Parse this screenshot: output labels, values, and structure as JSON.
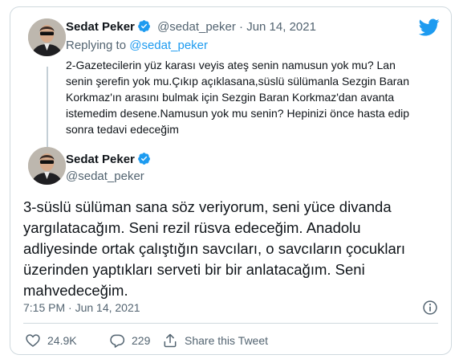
{
  "colors": {
    "accent": "#1d9bf0",
    "secondary_text": "#536471",
    "border": "#cfd9de",
    "thread_line": "#c4cfd6"
  },
  "icons": {
    "brand": "twitter-bird-icon",
    "verified": "verified-badge-icon",
    "info": "info-icon",
    "like": "heart-icon",
    "reply": "reply-icon",
    "share": "share-icon"
  },
  "reply_tweet": {
    "author_name": "Sedat Peker",
    "handle": "@sedat_peker",
    "separator": "·",
    "date": "Jun 14, 2021",
    "replying_to_label": "Replying to",
    "replying_to_handle": "@sedat_peker",
    "text_lines": [
      "2-Gazetecilerin yüz karası veyis ateş senin namusun yok mu? Lan",
      "senin şerefin yok mu.Çıkıp açıklasana,süslü sülümanla Sezgin Baran",
      "Korkmaz'ın arasını bulmak için Sezgin Baran Korkmaz'dan avanta",
      "istemedim desene.Namusun yok mu senin? Hepinizi önce hasta edip",
      "sonra tedavi edeceğim"
    ]
  },
  "main_tweet": {
    "author_name": "Sedat Peker",
    "handle": "@sedat_peker",
    "text_lines": [
      "3-süslü sülüman sana söz veriyorum, seni yüce divanda",
      "yargılatacağım. Seni rezil rüsva edeceğim. Anadolu",
      "adliyesinde ortak çalıştığın savcıları, o savcıların çocukları",
      "üzerinden yaptıkları serveti bir bir anlatacağım. Seni",
      "mahvedeceğim."
    ],
    "timestamp": "7:15 PM · Jun 14, 2021",
    "likes": "24.9K",
    "replies": "229",
    "share_label": "Share this Tweet"
  }
}
